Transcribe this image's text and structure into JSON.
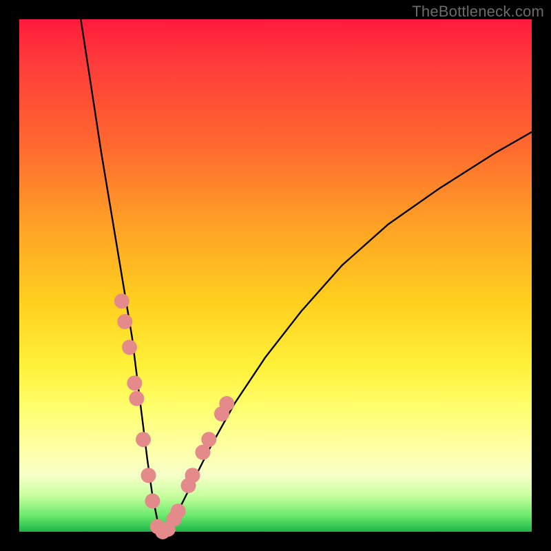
{
  "watermark": "TheBottleneck.com",
  "colors": {
    "frame": "#000000",
    "curve": "#000000",
    "dot_fill": "#e48a8a",
    "dot_stroke": "#c96e6e"
  },
  "chart_data": {
    "type": "line",
    "title": "",
    "xlabel": "",
    "ylabel": "",
    "xlim": [
      0,
      100
    ],
    "ylim": [
      0,
      100
    ],
    "series": [
      {
        "name": "bottleneck-curve",
        "x": [
          12,
          14,
          16,
          18,
          20,
          22,
          23,
          24,
          25,
          26,
          27,
          28,
          30,
          33,
          37,
          42,
          48,
          55,
          63,
          72,
          82,
          93,
          100
        ],
        "y": [
          100,
          87,
          74,
          62,
          50,
          38,
          30,
          22,
          14,
          7,
          2,
          0,
          2,
          8,
          16,
          25,
          34,
          43,
          52,
          60,
          67,
          74,
          78
        ]
      }
    ],
    "scatter": [
      {
        "name": "dots",
        "points": [
          {
            "x": 20.0,
            "y": 45
          },
          {
            "x": 20.6,
            "y": 41
          },
          {
            "x": 21.5,
            "y": 36
          },
          {
            "x": 22.5,
            "y": 29
          },
          {
            "x": 22.9,
            "y": 26
          },
          {
            "x": 24.2,
            "y": 18
          },
          {
            "x": 25.2,
            "y": 11
          },
          {
            "x": 26.0,
            "y": 6
          },
          {
            "x": 27.0,
            "y": 1
          },
          {
            "x": 28.0,
            "y": 0
          },
          {
            "x": 29.0,
            "y": 0.5
          },
          {
            "x": 30.2,
            "y": 2.5
          },
          {
            "x": 31.0,
            "y": 4
          },
          {
            "x": 33.0,
            "y": 9
          },
          {
            "x": 33.8,
            "y": 11
          },
          {
            "x": 35.8,
            "y": 15.5
          },
          {
            "x": 37.0,
            "y": 18
          },
          {
            "x": 39.5,
            "y": 23
          },
          {
            "x": 40.5,
            "y": 25
          }
        ]
      }
    ]
  }
}
